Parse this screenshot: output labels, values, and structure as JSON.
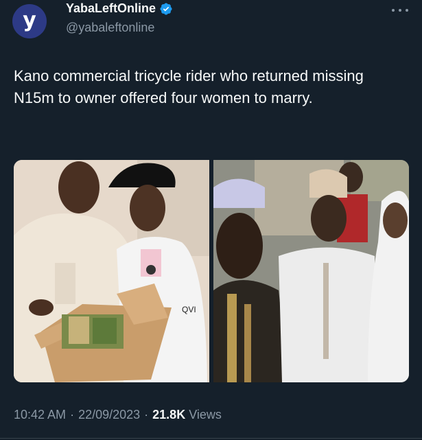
{
  "author": {
    "avatar_letter": "y",
    "display_name": "YabaLeftOnline",
    "handle": "@yabaleftonline",
    "verified_icon": "verified-badge-icon",
    "verified_color": "#1d9bf0"
  },
  "tweet": {
    "text": "Kano commercial tricycle rider who returned missing N15m to owner offered four women to marry.",
    "time": "10:42 AM",
    "separator": "·",
    "date": "22/09/2023",
    "views_count": "21.8K",
    "views_label": "Views"
  },
  "photos": {
    "left_shirt_text": "QVI"
  },
  "colors": {
    "background": "#15202b",
    "text_primary": "#f7f9f9",
    "text_secondary": "#8b98a5",
    "avatar_bg": "#2d3a86"
  }
}
